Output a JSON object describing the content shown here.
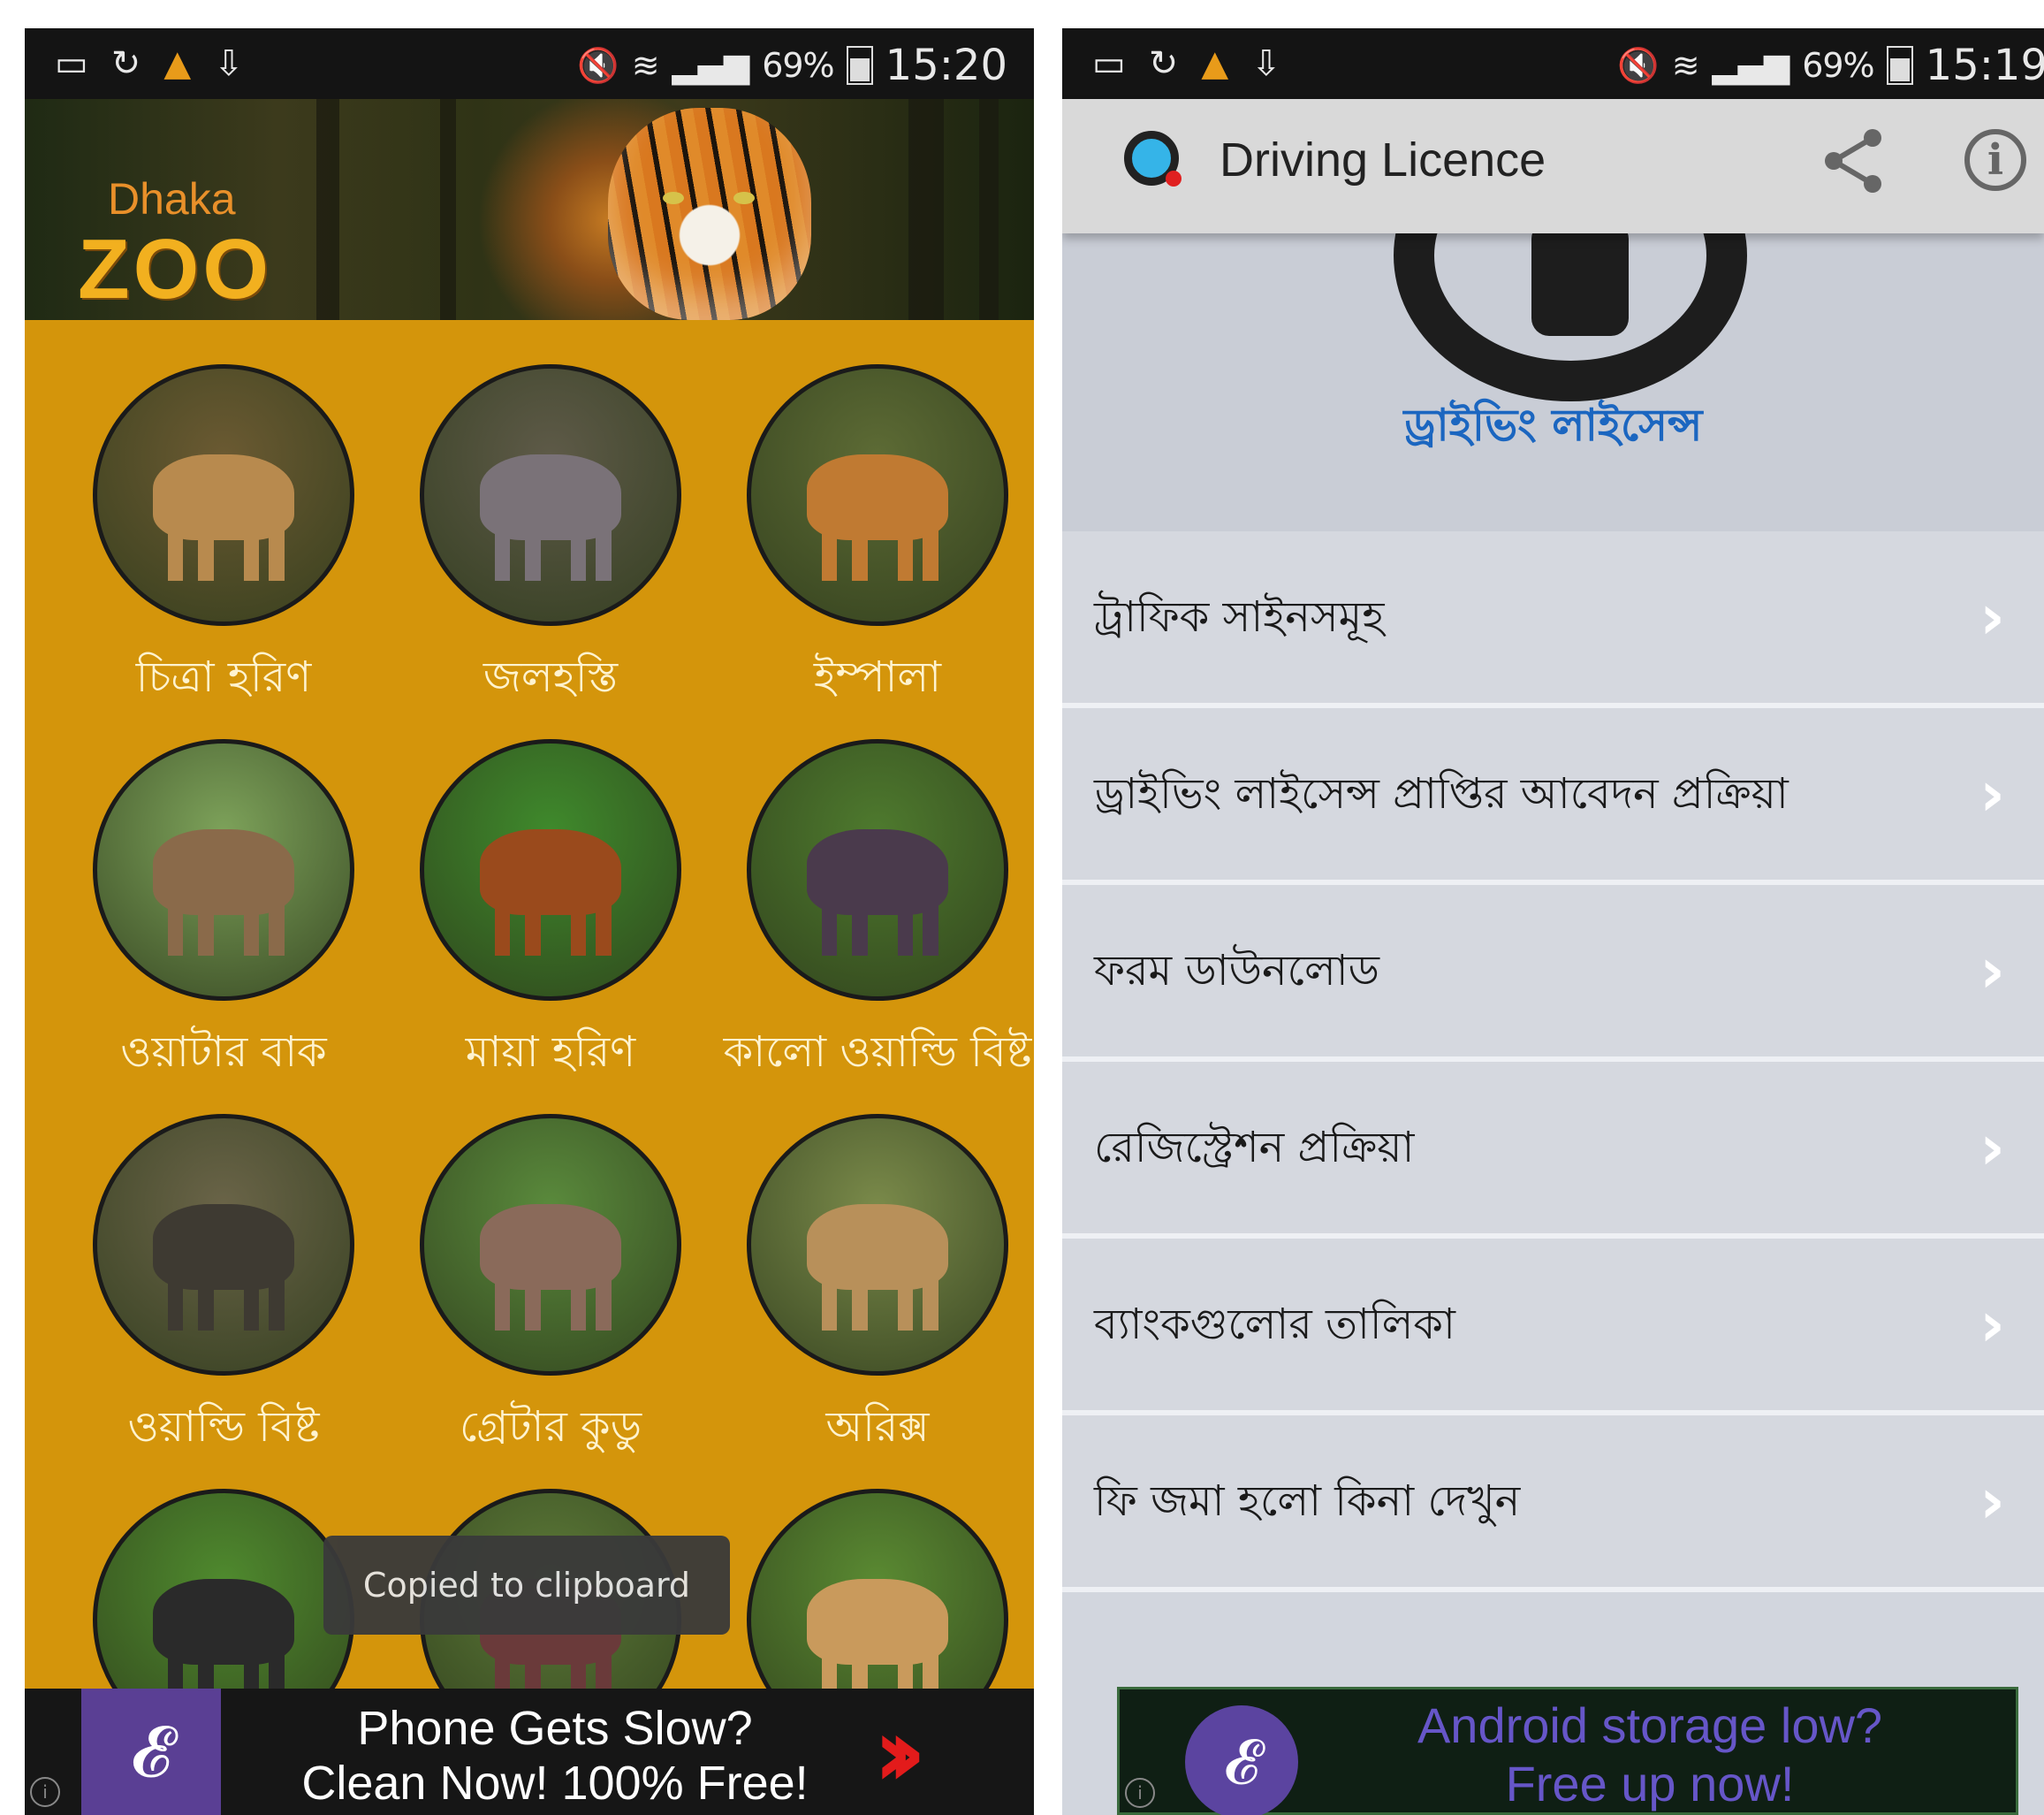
{
  "zoo_screen": {
    "status": {
      "percent": "69%",
      "time": "15:20"
    },
    "logo": {
      "line1": "Dhaka",
      "line2": "ZOO"
    },
    "animals": [
      {
        "label": "চিত্রা হরিণ",
        "colors": [
          "#6b5a32",
          "#b88a4e"
        ]
      },
      {
        "label": "জলহস্তি",
        "colors": [
          "#5e5a48",
          "#7a7278"
        ]
      },
      {
        "label": "ইম্পালা",
        "colors": [
          "#5d6b35",
          "#c07a32"
        ]
      },
      {
        "label": "ওয়াটার বাক",
        "colors": [
          "#7da25a",
          "#8a6a4a"
        ]
      },
      {
        "label": "মায়া হরিণ",
        "colors": [
          "#3f8a2c",
          "#9a4a1c"
        ]
      },
      {
        "label": "কালো ওয়াল্ডি বিষ্ট",
        "colors": [
          "#4e7a2e",
          "#4a3a4c"
        ]
      },
      {
        "label": "ওয়াল্ডি বিষ্ট",
        "colors": [
          "#6a6448",
          "#3e3a32"
        ]
      },
      {
        "label": "গ্রেটার কুডু",
        "colors": [
          "#5a8a3c",
          "#8a6a5a"
        ]
      },
      {
        "label": "অরিক্স",
        "colors": [
          "#7a8a4a",
          "#b8905a"
        ]
      },
      {
        "label": "",
        "colors": [
          "#4f8a2e",
          "#2a2a2a"
        ]
      },
      {
        "label": "",
        "colors": [
          "#5c7a38",
          "#6a3a3a"
        ]
      },
      {
        "label": "",
        "colors": [
          "#5a8a32",
          "#c99a5c"
        ]
      }
    ],
    "toast": "Copied to clipboard",
    "ad": {
      "line1": "Phone Gets Slow?",
      "line2": "Clean Now!  100% Free!"
    }
  },
  "driving_screen": {
    "status": {
      "percent": "69%",
      "time": "15:19"
    },
    "app_title": "Driving Licence",
    "hero_title": "ড্রাইভিং লাইসেন্স",
    "menu": [
      {
        "label": "ট্রাফিক সাইনসমূহ"
      },
      {
        "label": "ড্রাইভিং লাইসেন্স প্রাপ্তির আবেদন প্রক্রিয়া"
      },
      {
        "label": "ফরম ডাউনলোড"
      },
      {
        "label": "রেজিস্ট্রেশন প্রক্রিয়া"
      },
      {
        "label": "ব্যাংকগুলোর তালিকা"
      },
      {
        "label": "ফি জমা হলো কিনা দেখুন"
      }
    ],
    "ad": {
      "line1": "Android storage low?",
      "line2": "Free up now!"
    }
  },
  "icons": {
    "gallery": "▭",
    "sync": "↻",
    "warn": "▲",
    "download": "⇩",
    "mute": "🔇",
    "wifi": "≋",
    "signal": "▂▄▆",
    "chevron": "›",
    "share": "<",
    "info": "i",
    "ad_logo": "𝓔"
  }
}
